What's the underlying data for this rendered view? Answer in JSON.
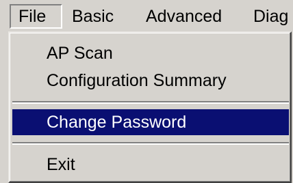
{
  "menubar": {
    "items": [
      {
        "label": "File"
      },
      {
        "label": "Basic"
      },
      {
        "label": "Advanced"
      },
      {
        "label": "Diag"
      }
    ]
  },
  "file_menu": {
    "items": [
      {
        "label": "AP Scan"
      },
      {
        "label": "Configuration Summary"
      },
      {
        "label": "Change Password"
      },
      {
        "label": "Exit"
      }
    ]
  },
  "colors": {
    "menu_background": "#d6d3ce",
    "highlight": "#0a0f72",
    "highlight_text": "#ffffff"
  }
}
